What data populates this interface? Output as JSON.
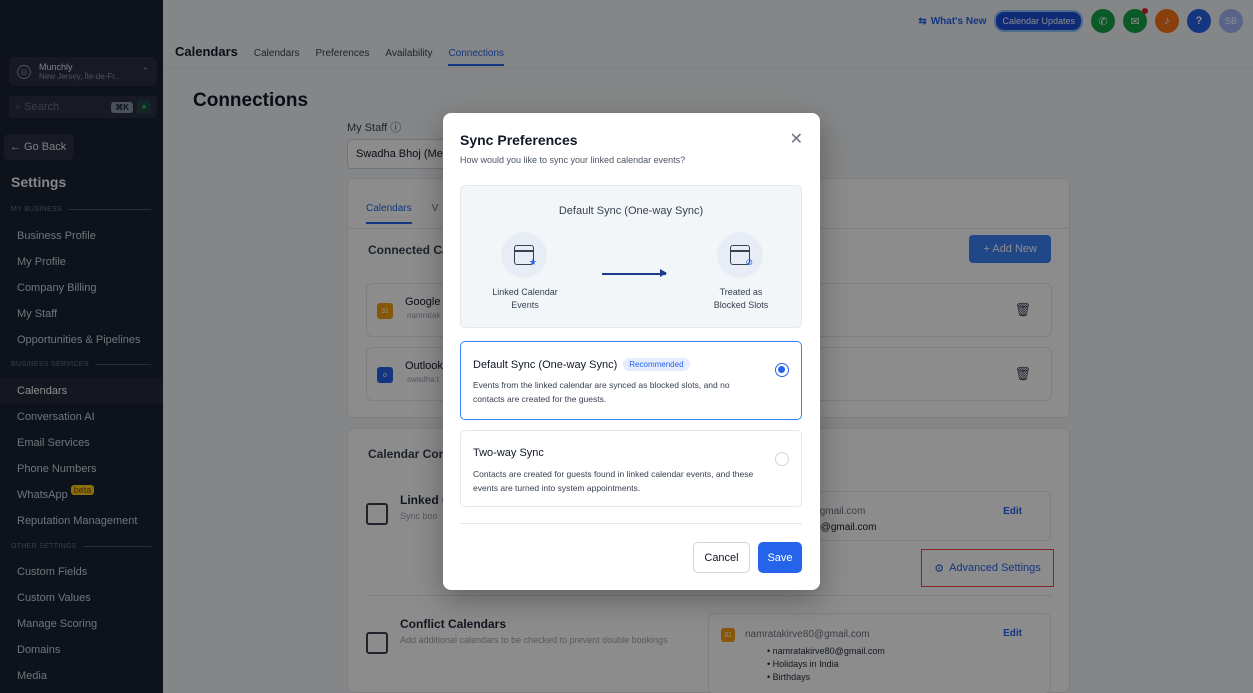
{
  "sidebar": {
    "location_name": "Munchly",
    "location_sub": "New Jersey, Île-de-Fr...",
    "search_placeholder": "Search",
    "search_shortcut": "⌘K",
    "go_back": "← Go Back",
    "settings_title": "Settings",
    "sec_my_business": "MY BUSINESS",
    "sec_business_services": "BUSINESS SERVICES",
    "sec_other_settings": "OTHER SETTINGS",
    "items": {
      "business_profile": "Business Profile",
      "my_profile": "My Profile",
      "company_billing": "Company Billing",
      "my_staff": "My Staff",
      "opportunities": "Opportunities & Pipelines",
      "calendars": "Calendars",
      "conversation_ai": "Conversation AI",
      "email_services": "Email Services",
      "phone_numbers": "Phone Numbers",
      "whatsapp": "WhatsApp",
      "whatsapp_badge": "beta",
      "reputation": "Reputation Management",
      "custom_fields": "Custom Fields",
      "custom_values": "Custom Values",
      "manage_scoring": "Manage Scoring",
      "domains": "Domains",
      "media": "Media"
    }
  },
  "topbar": {
    "whats_new": "What's New",
    "calendar_updates": "Calendar Updates",
    "avatar": "SB",
    "help": "?"
  },
  "tabs": {
    "brand": "Calendars",
    "items": [
      "Calendars",
      "Preferences",
      "Availability",
      "Connections"
    ]
  },
  "page": {
    "title": "Connections",
    "staff_label": "My Staff ⓘ",
    "staff_value": "Swadha Bhoj (Me)"
  },
  "card1": {
    "tab_calendars": "Calendars",
    "tab_v": "V",
    "heading": "Connected Ca",
    "add_new": "+ Add New",
    "accounts": [
      {
        "name": "Google",
        "email": "namratak"
      },
      {
        "name": "Outlook",
        "email": "swadha.t"
      }
    ]
  },
  "card2": {
    "heading": "Calendar Conf",
    "linked_title": "Linked C",
    "linked_sub": "Sync boo",
    "email_line1": "0@gmail.com",
    "email_line2": "e80@gmail.com",
    "edit": "Edit",
    "advanced_settings": "Advanced Settings",
    "conflict_title": "Conflict Calendars",
    "conflict_sub": "Add additional calendars to be checked to prevent double bookings",
    "conflict_email": "namratakirve80@gmail.com",
    "conflict_items": [
      "namratakirve80@gmail.com",
      "Holidays in India",
      "Birthdays"
    ]
  },
  "modal": {
    "title": "Sync Preferences",
    "subtitle": "How would you like to sync your linked calendar events?",
    "diagram_title": "Default Sync (One-way Sync)",
    "left_label_1": "Linked Calendar",
    "left_label_2": "Events",
    "right_label_1": "Treated as",
    "right_label_2": "Blocked Slots",
    "option1_title": "Default Sync (One-way Sync)",
    "option1_badge": "Recommended",
    "option1_desc": "Events from the linked calendar are synced as blocked slots, and no contacts are created for the guests.",
    "option2_title": "Two-way Sync",
    "option2_desc": "Contacts are created for guests found in linked calendar events, and these events are turned into system appointments.",
    "cancel": "Cancel",
    "save": "Save",
    "selected": "option1"
  },
  "colors": {
    "accent": "#2563eb",
    "sidebar_bg": "#1b2130",
    "highlight_border": "#ef4444"
  }
}
